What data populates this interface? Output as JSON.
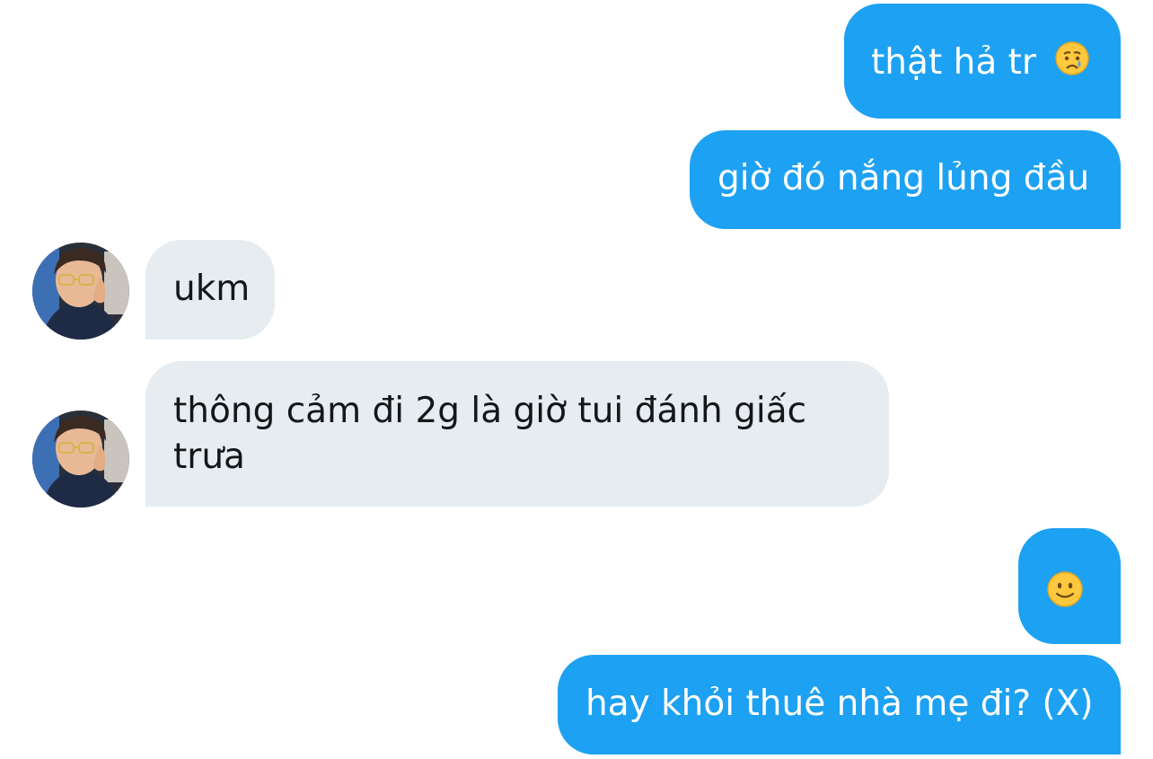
{
  "messages": [
    {
      "id": "m1",
      "direction": "sent",
      "text": "thật hả tr",
      "emoji": "crying-face"
    },
    {
      "id": "m2",
      "direction": "sent",
      "text": "giờ đó nắng lủng đầu"
    },
    {
      "id": "m3",
      "direction": "received",
      "text": "ukm"
    },
    {
      "id": "m4",
      "direction": "received",
      "lines": [
        "thông cảm đi 2g là giờ tui đánh giấc",
        "trưa"
      ]
    },
    {
      "id": "m5",
      "direction": "sent",
      "text": "",
      "emoji": "slightly-smiling-face"
    },
    {
      "id": "m6",
      "direction": "sent",
      "text": "hay khỏi thuê nhà mẹ đi? (X)"
    }
  ],
  "colors": {
    "sent_bubble": "#1da1f2",
    "received_bubble": "#e6ecf0",
    "sent_text": "#ffffff",
    "received_text": "#14171a"
  }
}
